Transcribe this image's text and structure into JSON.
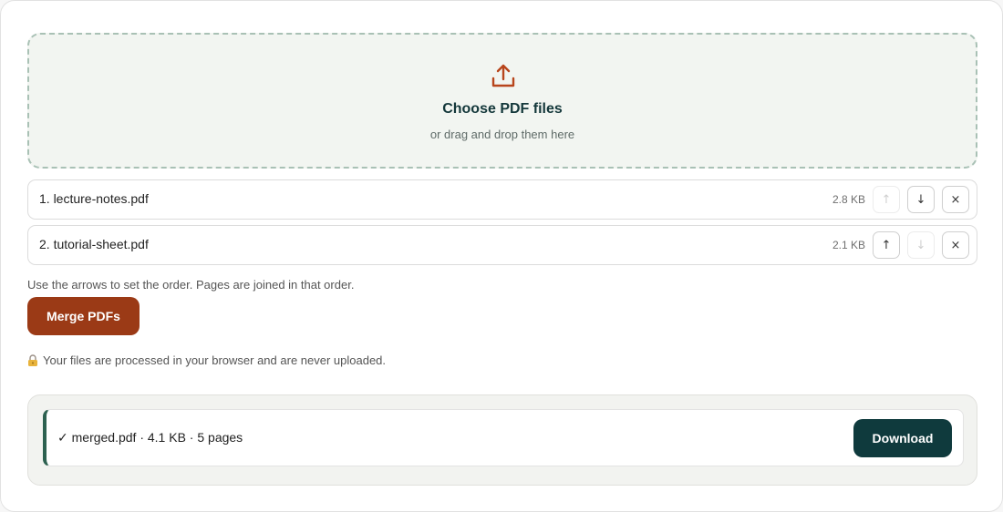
{
  "dropzone": {
    "title": "Choose PDF files",
    "subtitle": "or drag and drop them here",
    "icon": "upload-icon",
    "accent_color": "#b8451c"
  },
  "files": [
    {
      "name": "1. lecture-notes.pdf",
      "size": "2.8 KB",
      "up_label": "↑",
      "down_label": "↓",
      "remove_label": "×",
      "up_enabled": false,
      "down_enabled": true
    },
    {
      "name": "2. tutorial-sheet.pdf",
      "size": "2.1 KB",
      "up_label": "↑",
      "down_label": "↓",
      "remove_label": "×",
      "up_enabled": true,
      "down_enabled": false
    }
  ],
  "hint": "Use the arrows to set the order. Pages are joined in that order.",
  "merge_button": {
    "label": "Merge PDFs",
    "color": "#9b3a16"
  },
  "privacy": {
    "icon": "lock-icon",
    "text": "Your files are processed in your browser and are never uploaded."
  },
  "result": {
    "text": "✓ merged.pdf · 4.1 KB · 5 pages",
    "download_label": "Download",
    "accent_color": "#2d6150",
    "button_color": "#0f3a3d"
  }
}
